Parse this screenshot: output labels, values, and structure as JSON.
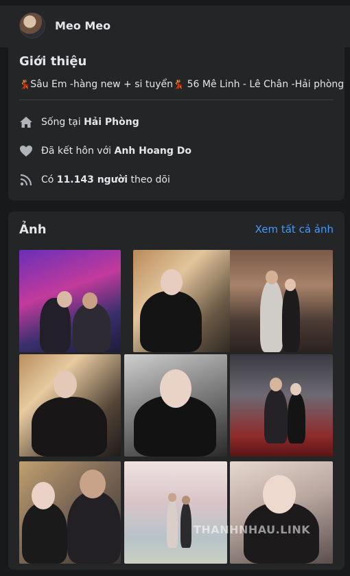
{
  "header": {
    "name": "Meo Meo"
  },
  "intro": {
    "title": "Giới thiệu",
    "bio": {
      "part1": "Sâu Em -hàng new + si tuyển",
      "part2": " 56 Mê Linh - Lê Chân -Hải phòng"
    },
    "lives": {
      "prefix": "Sống tại ",
      "value": "Hải Phòng"
    },
    "married": {
      "prefix": "Đã kết hôn với ",
      "value": "Anh Hoang Do"
    },
    "followers": {
      "prefix": "Có ",
      "value": "11.143 người",
      "suffix": " theo dõi"
    }
  },
  "photos": {
    "title": "Ảnh",
    "see_all": "Xem tất cả ảnh",
    "watermark": "THANHNHAU.LINK"
  },
  "icons": {
    "home": "home-icon",
    "heart": "heart-icon",
    "rss": "rss-icon",
    "dancer": "dancer-emoji"
  },
  "colors": {
    "background": "#18191a",
    "card": "#242526",
    "link": "#4599ff",
    "icon": "#b0b3b8"
  }
}
